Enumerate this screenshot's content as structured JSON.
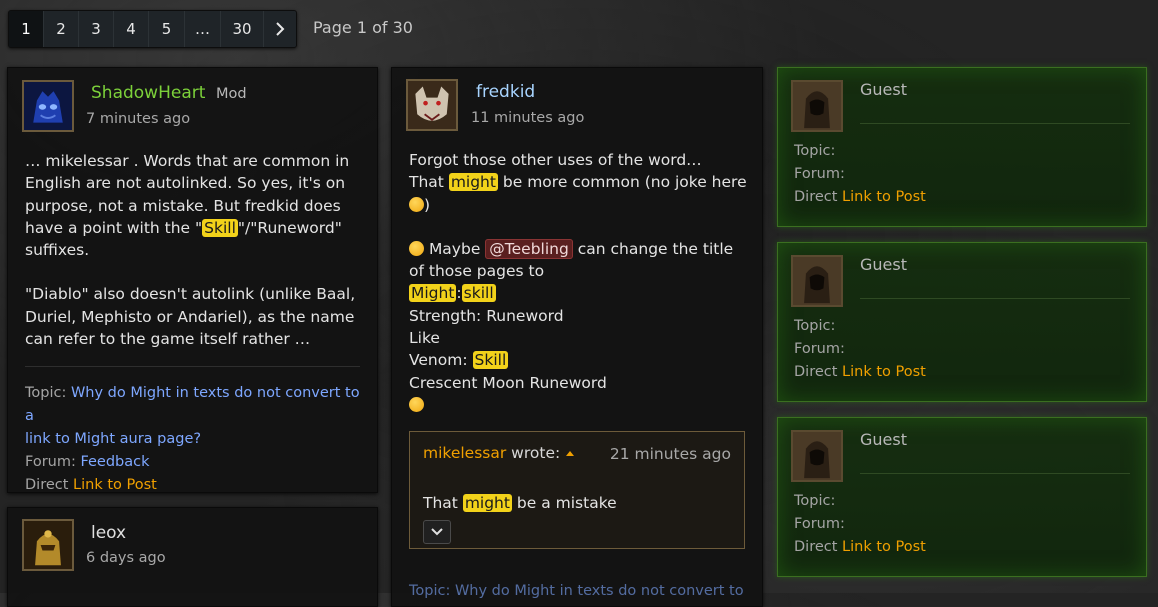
{
  "pagination": {
    "pages": [
      "1",
      "2",
      "3",
      "4",
      "5",
      "…",
      "30"
    ],
    "next_icon": "chevron-right-icon",
    "info": "Page 1 of 30"
  },
  "post1": {
    "username": "ShadowHeart",
    "role": "Mod",
    "time": "7 minutes ago",
    "p1_a": "… mikelessar . Words that are common in",
    "p1_b": "English are not autolinked. So yes, it's on",
    "p1_c": "purpose, not a mistake. But fredkid does",
    "p1_d1": "have a point with the \"",
    "p1_d_hl": "Skill",
    "p1_d2": "\"/\"Runeword\"",
    "p1_e": "suffixes.",
    "p2_a": "\"Diablo\" also doesn't autolink (unlike Baal,",
    "p2_b": "Duriel, Mephisto or Andariel), as the name",
    "p2_c": "can refer to the game itself rather …",
    "topic_label": "Topic:",
    "topic_link_a": "Why do Might in texts do not convert to a",
    "topic_link_b": "link to Might aura page?",
    "forum_label": "Forum:",
    "forum_link": "Feedback",
    "direct_label": "Direct",
    "direct_link": "Link to Post"
  },
  "post2": {
    "username": "leox",
    "time": "6 days ago"
  },
  "post3": {
    "username": "fredkid",
    "time": "11 minutes ago",
    "l1": "Forgot those other uses of the word…",
    "l2_a": "That",
    "l2_hl": "might",
    "l2_b": "be more common (no joke here",
    "l3_b": ")",
    "l4_a": "Maybe",
    "l4_mention": "@Teebling",
    "l4_b": "can change the title",
    "l5": "of those pages to",
    "l6_hl1": "Might",
    "l6_sep": ":",
    "l6_hl2": "skill",
    "l7": "Strength: Runeword",
    "l8": "Like",
    "l9_a": "Venom:",
    "l9_hl": "Skill",
    "l10": "Crescent Moon Runeword",
    "quote_author": "mikelessar",
    "quote_wrote": "wrote:",
    "quote_time": "21 minutes ago",
    "quote_a": "That",
    "quote_hl": "might",
    "quote_b": "be a mistake",
    "topic_partial": "Topic: Why do Might in texts do not convert to"
  },
  "guests": [
    {
      "name": "Guest",
      "topic": "Topic:",
      "forum": "Forum:",
      "direct": "Direct",
      "link": "Link to Post"
    },
    {
      "name": "Guest",
      "topic": "Topic:",
      "forum": "Forum:",
      "direct": "Direct",
      "link": "Link to Post"
    },
    {
      "name": "Guest",
      "topic": "Topic:",
      "forum": "Forum:",
      "direct": "Direct",
      "link": "Link to Post"
    }
  ],
  "colors": {
    "mod_name": "#7cd13a",
    "username": "#a8d4ff",
    "highlight": "#f2d21a",
    "link_blue": "#7ea7ff",
    "link_orange": "#f0a000",
    "guest_card": "#1a3a12"
  }
}
